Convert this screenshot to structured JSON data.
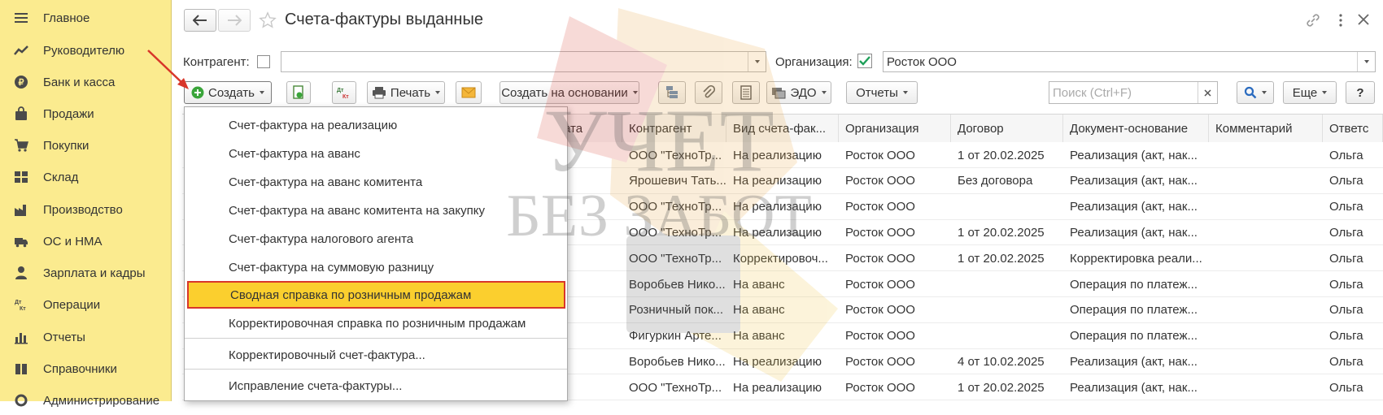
{
  "sidebar": {
    "items": [
      {
        "label": "Главное",
        "icon": "menu-icon"
      },
      {
        "label": "Руководителю",
        "icon": "trend-icon"
      },
      {
        "label": "Банк и касса",
        "icon": "coin-icon"
      },
      {
        "label": "Продажи",
        "icon": "bag-icon"
      },
      {
        "label": "Покупки",
        "icon": "cart-icon"
      },
      {
        "label": "Склад",
        "icon": "warehouse-icon"
      },
      {
        "label": "Производство",
        "icon": "factory-icon"
      },
      {
        "label": "ОС и НМА",
        "icon": "truck-icon"
      },
      {
        "label": "Зарплата и кадры",
        "icon": "person-icon"
      },
      {
        "label": "Операции",
        "icon": "dt-kt-icon"
      },
      {
        "label": "Отчеты",
        "icon": "bar-chart-icon"
      },
      {
        "label": "Справочники",
        "icon": "book-icon"
      },
      {
        "label": "Администрирование",
        "icon": "gear-icon"
      }
    ]
  },
  "header": {
    "title": "Счета-фактуры выданные"
  },
  "filters": {
    "counterparty_label": "Контрагент:",
    "counterparty_value": "",
    "organization_label": "Организация:",
    "organization_value": "Росток ООО"
  },
  "toolbar": {
    "create_label": "Создать",
    "print_label": "Печать",
    "create_based_label": "Создать на основании",
    "edo_label": "ЭДО",
    "reports_label": "Отчеты",
    "search_placeholder": "Поиск (Ctrl+F)",
    "more_label": "Еще",
    "help_label": "?"
  },
  "table": {
    "columns": [
      "ата",
      "Контрагент",
      "Вид счета-фак...",
      "Организация",
      "Договор",
      "Документ-основание",
      "Комментарий",
      "Ответс"
    ],
    "rows": [
      [
        "",
        "ООО \"ТехноТр...",
        "На реализацию",
        "Росток ООО",
        "1 от 20.02.2025",
        "Реализация (акт, нак...",
        "",
        "Ольга"
      ],
      [
        "",
        "Ярошевич Тать...",
        "На реализацию",
        "Росток ООО",
        "Без договора",
        "Реализация (акт, нак...",
        "",
        "Ольга"
      ],
      [
        "",
        "ООО \"ТехноТр...",
        "На реализацию",
        "Росток ООО",
        "",
        "Реализация (акт, нак...",
        "",
        "Ольга"
      ],
      [
        "",
        "ООО \"ТехноТр...",
        "На реализацию",
        "Росток ООО",
        "1 от 20.02.2025",
        "Реализация (акт, нак...",
        "",
        "Ольга"
      ],
      [
        "",
        "ООО \"ТехноТр...",
        "Корректировоч...",
        "Росток ООО",
        "1 от 20.02.2025",
        "Корректировка реали...",
        "",
        "Ольга"
      ],
      [
        "",
        "Воробьев Нико...",
        "На аванс",
        "Росток ООО",
        "",
        "Операция по платеж...",
        "",
        "Ольга"
      ],
      [
        "",
        "Розничный пок...",
        "На аванс",
        "Росток ООО",
        "",
        "Операция по платеж...",
        "",
        "Ольга"
      ],
      [
        "",
        "Фигуркин Арте...",
        "На аванс",
        "Росток ООО",
        "",
        "Операция по платеж...",
        "",
        "Ольга"
      ],
      [
        "",
        "Воробьев Нико...",
        "На реализацию",
        "Росток ООО",
        "4 от 10.02.2025",
        "Реализация (акт, нак...",
        "",
        "Ольга"
      ],
      [
        "",
        "ООО \"ТехноТр...",
        "На реализацию",
        "Росток ООО",
        "1 от 20.02.2025",
        "Реализация (акт, нак...",
        "",
        "Ольга"
      ]
    ]
  },
  "menu": {
    "items": [
      "Счет-фактура на реализацию",
      "Счет-фактура на аванс",
      "Счет-фактура на аванс комитента",
      "Счет-фактура на аванс комитента на закупку",
      "Счет-фактура налогового агента",
      "Счет-фактура на суммовую разницу",
      "Сводная справка по розничным продажам",
      "Корректировочная справка по розничным продажам",
      "Корректировочный счет-фактура...",
      "Исправление счета-фактуры..."
    ],
    "selected_index": 6
  },
  "watermark": {
    "line1": "УЧЕТ",
    "line2": "БЕЗ ЗАБОТ"
  },
  "colors": {
    "sidebar_bg": "#fbeb8f",
    "selected_bg": "#fbcf2e",
    "selected_border": "#d8362a",
    "create_icon": "#3aa53a",
    "arrow": "#d8362a"
  }
}
